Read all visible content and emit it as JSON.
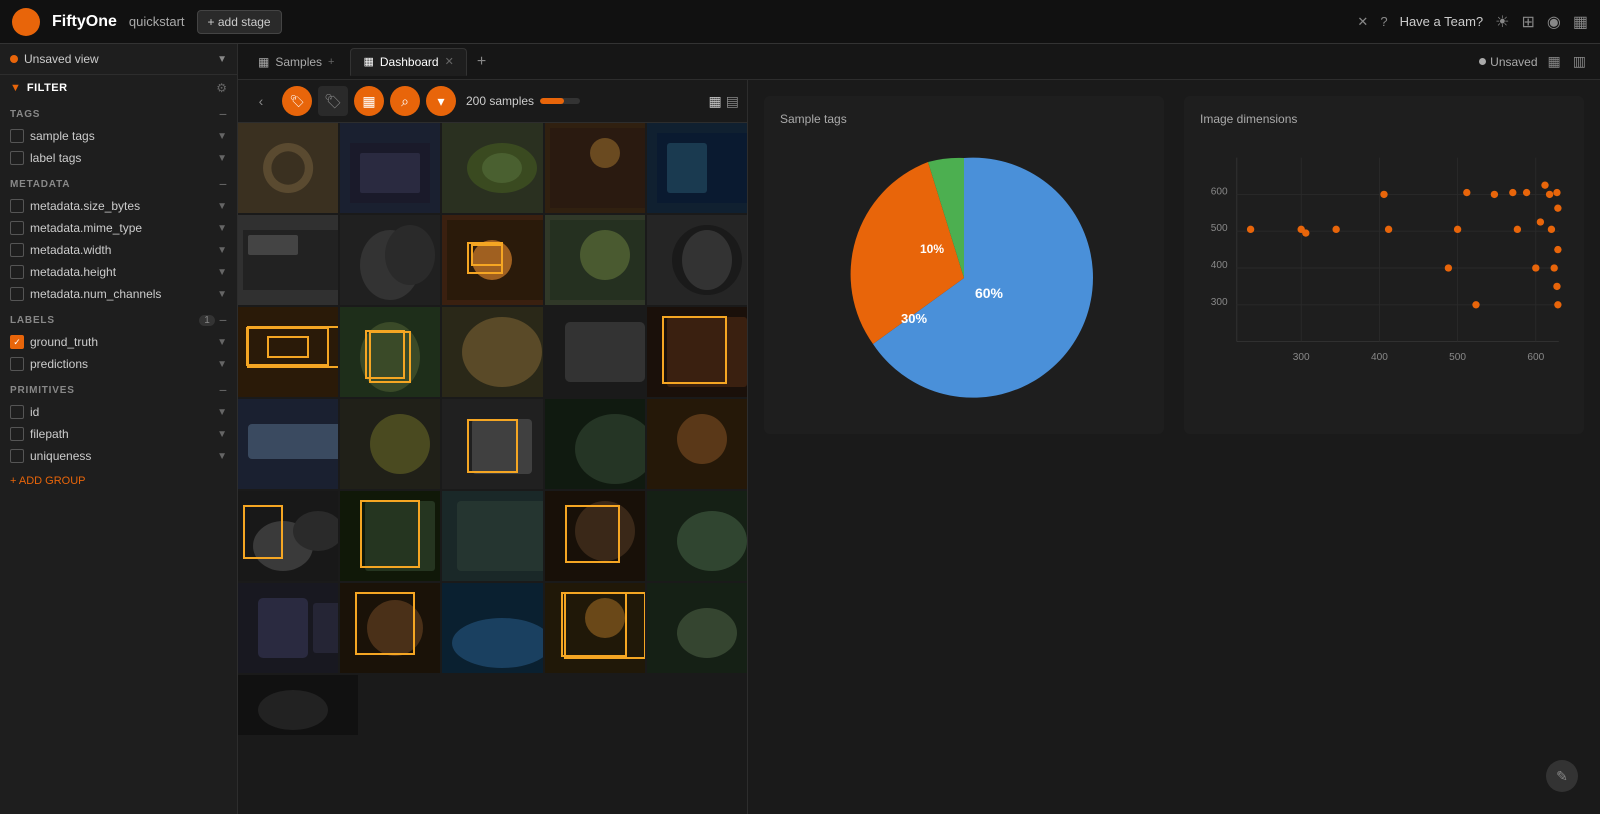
{
  "app": {
    "name": "FiftyOne",
    "subtitle": "quickstart",
    "add_stage": "+ add stage"
  },
  "topbar": {
    "have_team": "Have a Team?",
    "actions": [
      "☀",
      "⊞",
      "◉",
      "▦"
    ]
  },
  "sidebar": {
    "view_label": "Unsaved view",
    "filter_title": "FILTER",
    "sections": {
      "tags": {
        "title": "TAGS",
        "items": [
          "sample tags",
          "label tags"
        ]
      },
      "metadata": {
        "title": "METADATA",
        "items": [
          "metadata.size_bytes",
          "metadata.mime_type",
          "metadata.width",
          "metadata.height",
          "metadata.num_channels"
        ]
      },
      "labels": {
        "title": "LABELS",
        "count": "1",
        "items": [
          {
            "label": "ground_truth",
            "checked": true
          },
          {
            "label": "predictions",
            "checked": false
          }
        ]
      },
      "primitives": {
        "title": "PRIMITIVES",
        "items": [
          "id",
          "filepath",
          "uniqueness"
        ]
      }
    },
    "add_group": "+ ADD GROUP"
  },
  "tabs": {
    "samples": {
      "label": "Samples",
      "active": false
    },
    "dashboard": {
      "label": "Dashboard",
      "active": true
    }
  },
  "samples_panel": {
    "count": "200 samples",
    "grid_layout": true
  },
  "dashboard": {
    "sample_tags": {
      "title": "Sample tags",
      "pie": {
        "segments": [
          {
            "label": "60%",
            "value": 60,
            "color": "#4a90d9"
          },
          {
            "label": "30%",
            "value": 30,
            "color": "#e8650a"
          },
          {
            "label": "10%",
            "value": 10,
            "color": "#4caf50"
          }
        ]
      }
    },
    "image_dimensions": {
      "title": "Image dimensions",
      "x_labels": [
        "300",
        "400",
        "500",
        "600"
      ],
      "y_labels": [
        "300",
        "400",
        "500",
        "600"
      ]
    }
  },
  "status": {
    "unsaved": "Unsaved"
  }
}
